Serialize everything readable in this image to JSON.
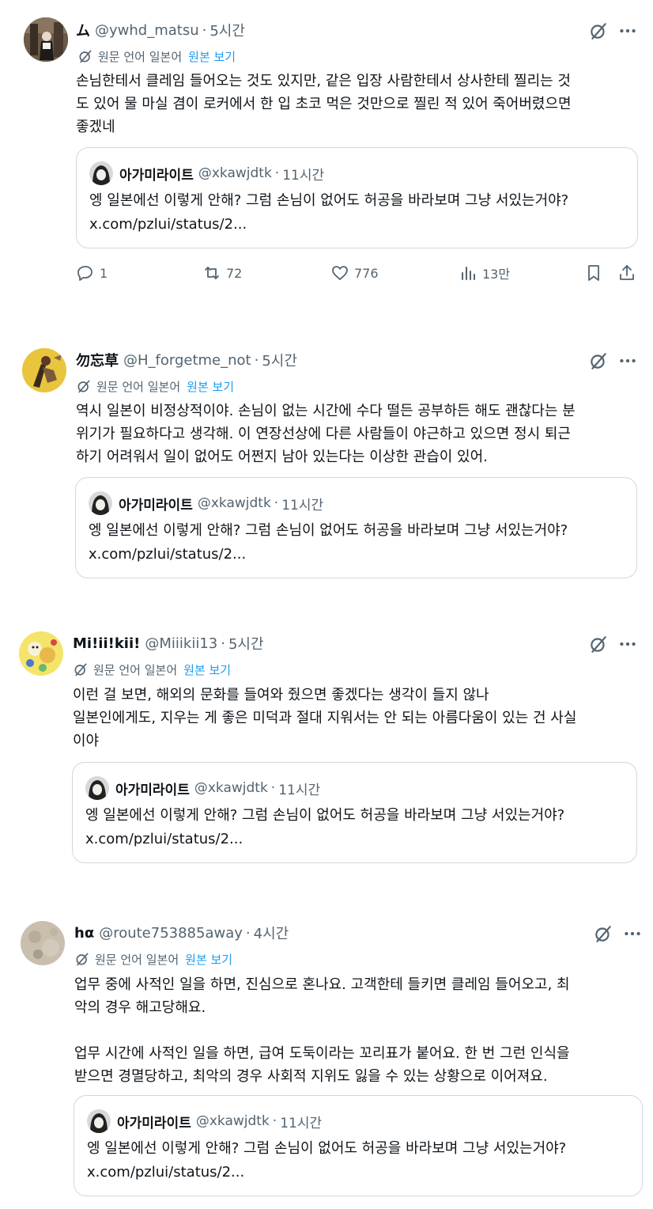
{
  "translation": {
    "prefix": "원문 언어 일본어",
    "show_original": "원본 보기"
  },
  "quote": {
    "name": "아가미라이트",
    "handle": "@xkawjdtk",
    "time": "11시간",
    "line1": "엥 일본에선 이렇게 안해? 그럼 손님이 없어도 허공을 바라보며 그냥 서있는거야?",
    "line2": "x.com/pzlui/status/2..."
  },
  "tweets": [
    {
      "name": "ム",
      "handle": "@ywhd_matsu",
      "time": "5시간",
      "body": "손님한테서 클레임 들어오는 것도 있지만, 같은 입장 사람한테서 상사한테 찔리는 것\n도 있어 물 마실 겸이 로커에서 한 입 초코 먹은 것만으로 찔린 적 있어 죽어버렸으면\n좋겠네",
      "actions": {
        "reply": "1",
        "retweet": "72",
        "like": "776",
        "views": "13만"
      }
    },
    {
      "name": "勿忘草",
      "handle": "@H_forgetme_not",
      "time": "5시간",
      "body": "역시 일본이 비정상적이야. 손님이 없는 시간에 수다 떨든 공부하든 해도 괜찮다는 분\n위기가 필요하다고 생각해. 이 연장선상에 다른 사람들이 야근하고 있으면 정시 퇴근\n하기 어려워서 일이 없어도 어쩐지 남아 있는다는 이상한 관습이 있어."
    },
    {
      "name": "Mi!ii!kii!",
      "handle": "@Miiikii13",
      "time": "5시간",
      "body": "이런 걸 보면, 해외의 문화를 들여와 줬으면 좋겠다는 생각이 들지 않나\n일본인에게도, 지우는 게 좋은 미덕과 절대 지워서는 안 되는 아름다움이 있는 건 사실\n이야"
    },
    {
      "name": "hα",
      "handle": "@route753885away",
      "time": "4시간",
      "body": "업무 중에 사적인 일을 하면, 진심으로 혼나요. 고객한테 들키면 클레임 들어오고, 최\n악의 경우 해고당해요.\n\n업무 시간에 사적인 일을 하면, 급여 도둑이라는 꼬리표가 붙어요. 한 번 그런 인식을\n받으면 경멸당하고, 최악의 경우 사회적 지위도 잃을 수 있는 상황으로 이어져요."
    }
  ]
}
